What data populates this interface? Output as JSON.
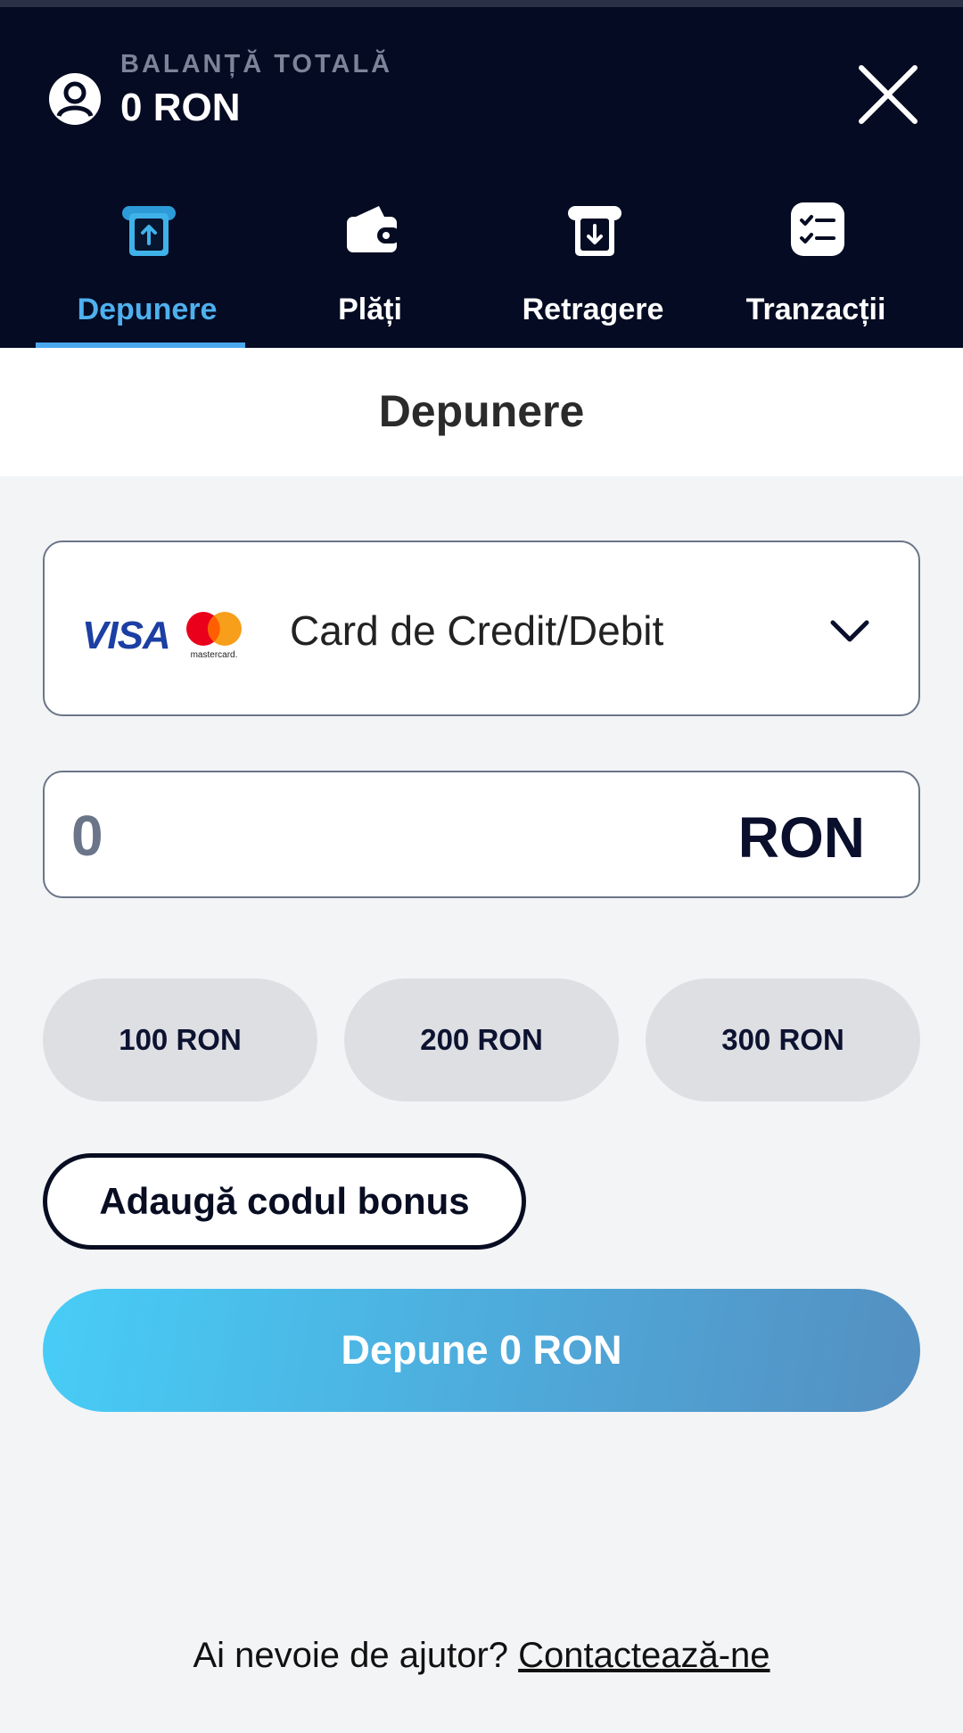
{
  "header": {
    "balance_label": "BALANȚĂ TOTALĂ",
    "balance_value": "0 RON",
    "tabs": [
      {
        "label": "Depunere",
        "icon": "deposit-icon",
        "active": true
      },
      {
        "label": "Plăți",
        "icon": "wallet-icon",
        "active": false
      },
      {
        "label": "Retragere",
        "icon": "withdraw-icon",
        "active": false
      },
      {
        "label": "Tranzacții",
        "icon": "transactions-icon",
        "active": false
      }
    ]
  },
  "main": {
    "title": "Depunere",
    "payment_method": {
      "visa_text": "VISA",
      "mastercard_text": "mastercard.",
      "label": "Card de Credit/Debit"
    },
    "amount": {
      "placeholder": "0",
      "currency": "RON"
    },
    "presets": [
      "100 RON",
      "200 RON",
      "300 RON"
    ],
    "bonus_label": "Adaugă codul bonus",
    "submit_label": "Depune 0 RON",
    "help_text": "Ai nevoie de ajutor?",
    "help_link": "Contactează-ne"
  },
  "colors": {
    "header_bg": "#050b22",
    "accent": "#4aa7ec",
    "button_gradient_start": "#47cdf7",
    "button_gradient_end": "#548fc0"
  }
}
